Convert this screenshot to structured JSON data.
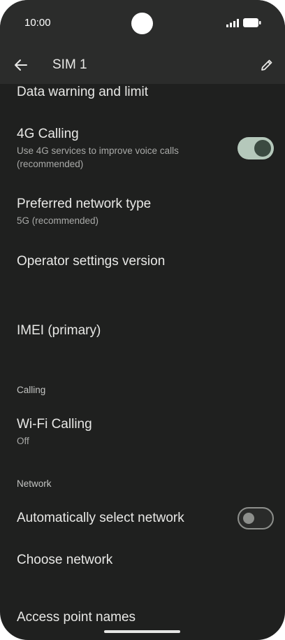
{
  "status_bar": {
    "time": "10:00"
  },
  "app_bar": {
    "title": "SIM 1"
  },
  "settings": {
    "data_warning": "Data warning and limit",
    "calling_4g": {
      "title": "4G Calling",
      "subtitle_line1": "Use 4G services to improve voice calls",
      "subtitle_line2": "(recommended)",
      "enabled": true
    },
    "preferred_network": {
      "title": "Preferred network type",
      "subtitle": "5G (recommended)"
    },
    "operator_version": {
      "title": "Operator settings version"
    },
    "imei": {
      "title": "IMEI (primary)"
    },
    "section_calling": "Calling",
    "wifi_calling": {
      "title": "Wi-Fi Calling",
      "subtitle": "Off"
    },
    "section_network": "Network",
    "auto_select": {
      "title": "Automatically select network",
      "enabled": false
    },
    "choose_network": {
      "title": "Choose network"
    },
    "apn": {
      "title": "Access point names"
    }
  },
  "colors": {
    "background": "#1f201f",
    "appbar": "#2b2c2b",
    "toggle_on": "#b5c8bb",
    "toggle_on_knob": "#3b4a41"
  },
  "icons": {
    "back": "arrow-left",
    "edit": "pencil"
  }
}
